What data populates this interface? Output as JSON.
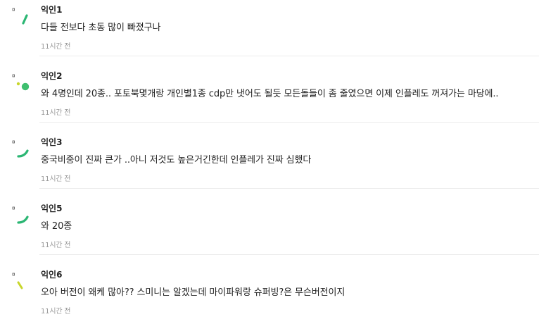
{
  "comments": [
    {
      "nickname": "익인1",
      "content": "다들 전보다 초동 많이 빠졌구나",
      "time": "11시간 전",
      "avatar_icon": "dot-and-slash-icon",
      "avatar_color": "#2bb673"
    },
    {
      "nickname": "익인2",
      "content": "와 4명인데 20종.. 포토북몇개랑 개인별1종 cdp만 냇어도 될듯 모든돌들이 좀 줄였으면 이제 인플레도 꺼져가는 마당에..",
      "time": "11시간 전",
      "avatar_icon": "dots-icon",
      "avatar_color": "#3fbf6f",
      "avatar_accent": "#c8d62b"
    },
    {
      "nickname": "익인3",
      "content": "중국비중이 진짜 큰가 ..아니 저것도 높은거긴한데 인플레가 진짜 심했다",
      "time": "11시간 전",
      "avatar_icon": "dot-and-curve-icon",
      "avatar_color": "#2bb673"
    },
    {
      "nickname": "익인5",
      "content": "와 20종",
      "time": "11시간 전",
      "avatar_icon": "dot-and-curve-icon",
      "avatar_color": "#2bb673"
    },
    {
      "nickname": "익인6",
      "content": "오아 버전이 왜케 많아?? 스미니는 알겠는데 마이파워랑 슈퍼빙?은 무슨버전이지",
      "time": "11시간 전",
      "avatar_icon": "dot-and-slash-icon",
      "avatar_color": "#c8d62b"
    }
  ]
}
